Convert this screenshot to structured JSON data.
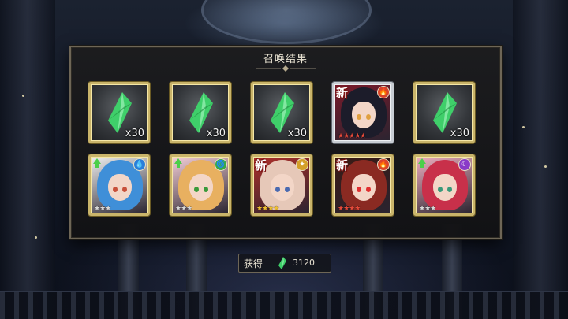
{
  "panel": {
    "title": "召唤结果"
  },
  "results": [
    {
      "type": "crystal",
      "quantity": "x30",
      "frame": "gold"
    },
    {
      "type": "crystal",
      "quantity": "x30",
      "frame": "gold"
    },
    {
      "type": "crystal",
      "quantity": "x30",
      "frame": "gold"
    },
    {
      "type": "character",
      "new": "新",
      "element": "fire",
      "element_color": "#d9432a",
      "stars": "★★★★★",
      "star_color": "#e64a3a",
      "frame": "silver",
      "hair": "#1c1c2a",
      "accent": "#7a1a2a",
      "eye": "#e0a040"
    },
    {
      "type": "crystal",
      "quantity": "x30",
      "frame": "gold"
    },
    {
      "type": "character",
      "upgrade": true,
      "element": "water",
      "element_color": "#2a7fd9",
      "stars": "★★★",
      "star_color": "#d8d8d8",
      "frame": "gold",
      "hair": "#3f8fd8",
      "accent": "#f0f0f0",
      "eye": "#c8503a"
    },
    {
      "type": "character",
      "upgrade": true,
      "element": "wind",
      "element_color": "#3aa84a",
      "stars": "★★★",
      "star_color": "#d8d8d8",
      "frame": "gold",
      "hair": "#e8b060",
      "accent": "#f6d0d8",
      "eye": "#3a9a3a"
    },
    {
      "type": "character",
      "new": "新",
      "element": "light",
      "element_color": "#d4a02a",
      "stars": "★★★★",
      "star_color": "#f0c030",
      "frame": "gold",
      "hair": "#e6c8b8",
      "accent": "#b0302a",
      "eye": "#4a6ab0"
    },
    {
      "type": "character",
      "new": "新",
      "element": "fire",
      "element_color": "#d9432a",
      "stars": "★★★★",
      "star_color": "#e64a3a",
      "frame": "gold",
      "hair": "#8a2a22",
      "accent": "#3a1a14",
      "eye": "#e03030"
    },
    {
      "type": "character",
      "upgrade": true,
      "element": "dark",
      "element_color": "#8a3ac8",
      "stars": "★★★",
      "star_color": "#d8d8d8",
      "frame": "gold",
      "hair": "#c8304a",
      "accent": "#f0b0c0",
      "eye": "#3a9a7a"
    }
  ],
  "reward": {
    "label": "获得",
    "icon": "green-crystal-icon",
    "value": "3120"
  },
  "colors": {
    "frame_gold": "#c9b46a",
    "frame_silver": "#c8cdd3",
    "crystal_green": "#3fcf6a",
    "panel_border": "#6e6656"
  }
}
